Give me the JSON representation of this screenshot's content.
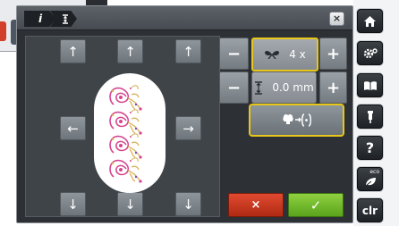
{
  "dialog": {
    "tabs": [
      {
        "label": "i"
      },
      {
        "label": ""
      }
    ],
    "close_label": "×"
  },
  "work_area": {
    "move_up_label": "↑",
    "move_down_label": "↓",
    "move_left_label": "←",
    "move_right_label": "→"
  },
  "repeat": {
    "minus_label": "−",
    "plus_label": "+",
    "value": "4 x"
  },
  "spacing": {
    "minus_label": "−",
    "plus_label": "+",
    "value": "0.0 mm"
  },
  "actions": {
    "cancel_label": "×",
    "confirm_label": "✓"
  },
  "sidebar": {
    "items": [
      {
        "icon": "home-icon"
      },
      {
        "icon": "settings-icon"
      },
      {
        "icon": "book-icon"
      },
      {
        "icon": "needle-icon"
      },
      {
        "icon": "help-icon",
        "label": "?"
      },
      {
        "icon": "eco-icon",
        "label": "eco"
      },
      {
        "icon": "clear-icon",
        "label": "clr"
      }
    ]
  },
  "colors": {
    "accent": "#e8c61a",
    "cancel": "#d0402a",
    "confirm": "#7bc236",
    "motif_pink": "#d6458f",
    "motif_gold": "#d9b25a"
  }
}
